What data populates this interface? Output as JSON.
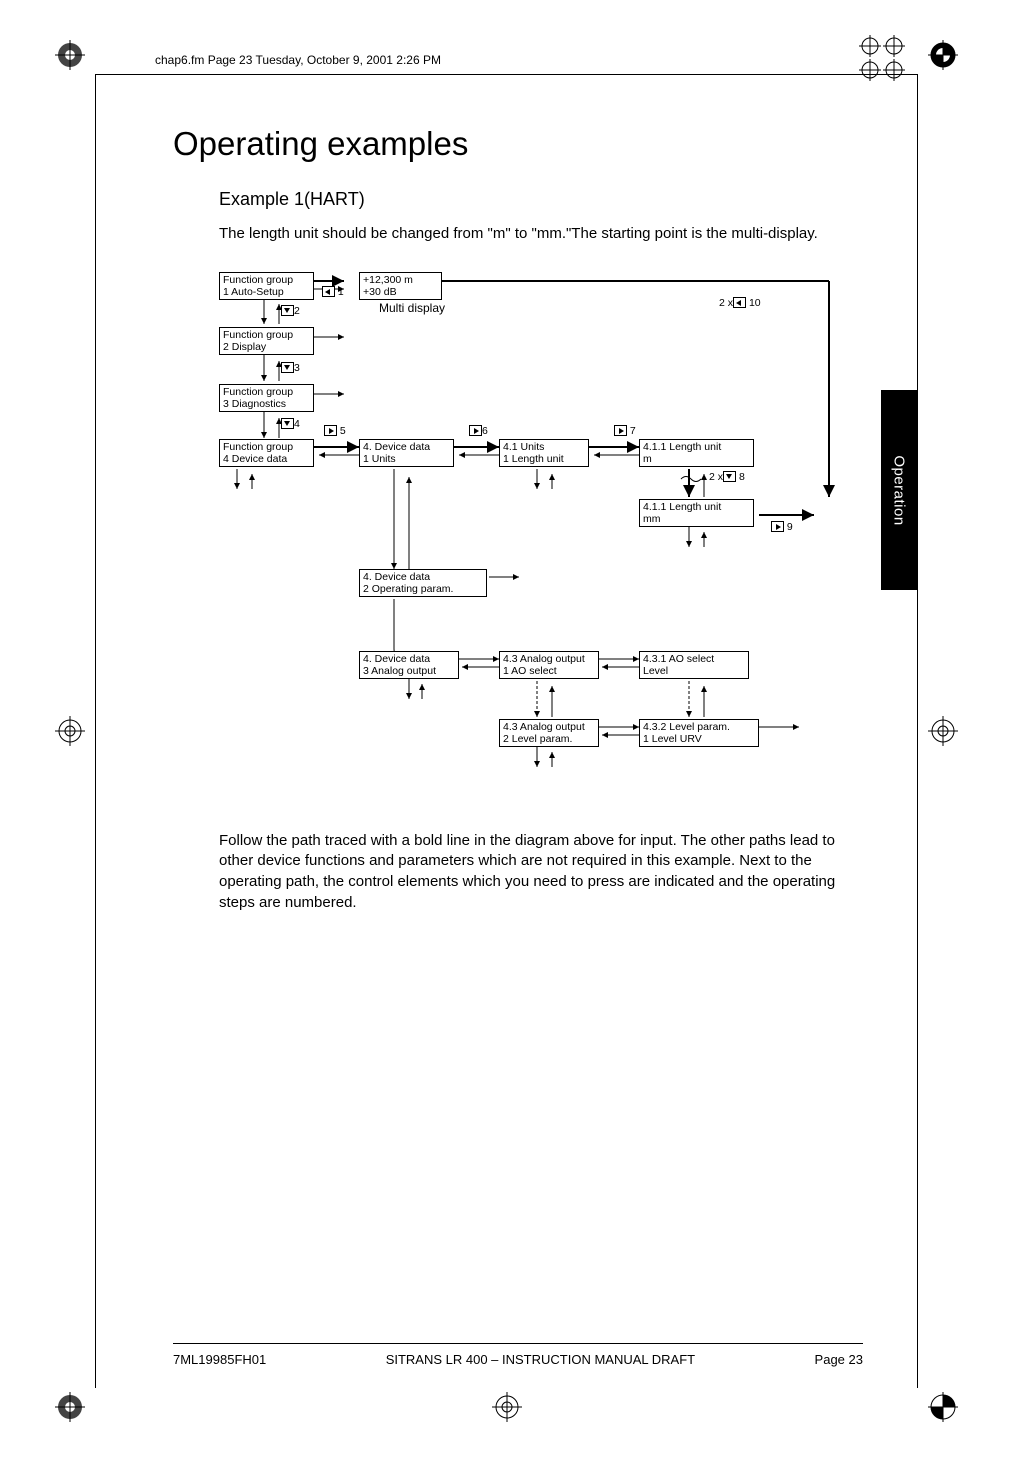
{
  "header_note": "chap6.fm  Page 23  Tuesday, October 9, 2001  2:26 PM",
  "side_tab": "Operation",
  "title": "Operating examples",
  "subtitle": "Example 1(HART)",
  "intro": "The length unit should be changed from \"m\" to \"mm.\"The starting point is the multi-display.",
  "diagram": {
    "boxes": {
      "fg1": {
        "line1": "Function group",
        "line2": "1 Auto-Setup"
      },
      "fg2": {
        "line1": "Function group",
        "line2": "2 Display"
      },
      "fg3": {
        "line1": "Function group",
        "line2": "3 Diagnostics"
      },
      "fg4": {
        "line1": "Function group",
        "line2": "4 Device data"
      },
      "multi": {
        "line1": "+12,300 m",
        "line2": "+30 dB"
      },
      "dd1": {
        "line1": "4. Device data",
        "line2": "1 Units"
      },
      "dd2": {
        "line1": "4. Device data",
        "line2": "2 Operating param."
      },
      "dd3": {
        "line1": "4. Device data",
        "line2": "3 Analog output"
      },
      "u41": {
        "line1": "4.1 Units",
        "line2": "1 Length unit"
      },
      "u411m": {
        "line1": "4.1.1 Length unit",
        "line2": "m"
      },
      "u411mm": {
        "line1": "4.1.1 Length unit",
        "line2": "mm"
      },
      "ao43_1": {
        "line1": "4.3 Analog output",
        "line2": "1 AO select"
      },
      "ao43_2": {
        "line1": "4.3 Analog output",
        "line2": "2 Level param."
      },
      "ao431": {
        "line1": "4.3.1 AO select",
        "line2": "Level"
      },
      "ao432": {
        "line1": "4.3.2 Level param.",
        "line2": "1 Level URV"
      }
    },
    "labels": {
      "multidisplay": "Multi display",
      "step1": "1",
      "step2": "2",
      "step3": "3",
      "step4": "4",
      "step5": "5",
      "step6": "6",
      "step7": "7",
      "step8": "2 x",
      "step8n": "8",
      "step9": "9",
      "step10": "2 x",
      "step10n": "10"
    }
  },
  "followup": "Follow the path traced with a bold line in the diagram above for input. The other paths lead to other device functions and parameters which are not required in this example. Next to the operating path, the control elements which you need to press are indicated and the operating steps are numbered.",
  "footer": {
    "left": "7ML19985FH01",
    "center": "SITRANS LR 400 – INSTRUCTION MANUAL DRAFT",
    "right": "Page 23"
  }
}
